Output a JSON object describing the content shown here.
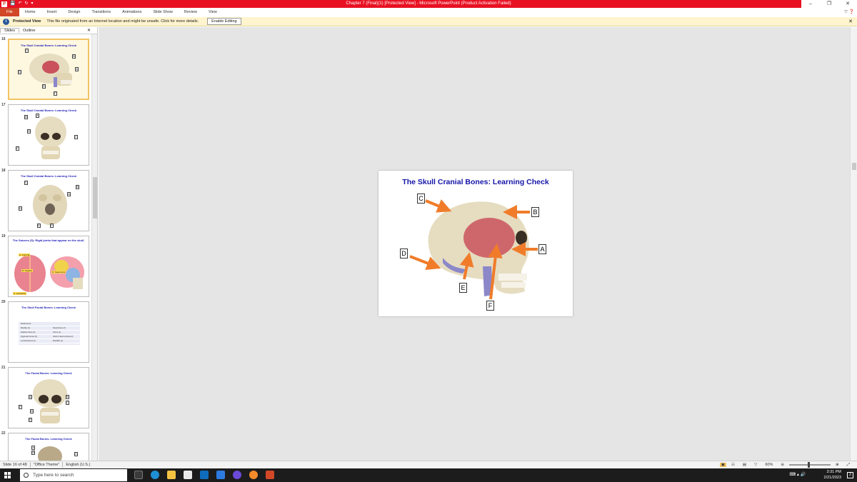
{
  "window": {
    "title": "Chapter 7 (Final)(1) [Protected View] - Microsoft PowerPoint (Product Activation Failed)",
    "app_icon": "P",
    "controls": [
      "–",
      "❐",
      "✕"
    ]
  },
  "ribbon": {
    "tabs": [
      "File",
      "Home",
      "Insert",
      "Design",
      "Transitions",
      "Animations",
      "Slide Show",
      "Review",
      "View"
    ]
  },
  "protected_view": {
    "label": "Protected View",
    "message": "This file originated from an Internet location and might be unsafe. Click for more details.",
    "button": "Enable Editing"
  },
  "slide_pane": {
    "tabs": [
      "Slides",
      "Outline"
    ],
    "thumbnails": [
      {
        "number": "16",
        "title": "The Skull Cranial Bones: Learning Check",
        "active": true
      },
      {
        "number": "17",
        "title": "The Skull Cranial Bones: Learning Check",
        "active": false
      },
      {
        "number": "18",
        "title": "The Skull Cranial Bones: Learning Check",
        "active": false
      },
      {
        "number": "19",
        "title": "The Sutures (5): Rigid joints that appear on the skull.",
        "active": false
      },
      {
        "number": "20",
        "title": "The Skull Facial Bones: Learning Check",
        "active": false
      },
      {
        "number": "21",
        "title": "The Facial Bones: Learning Check",
        "active": false
      },
      {
        "number": "22",
        "title": "The Facial Bones: Learning Check",
        "active": false
      }
    ],
    "slide19_labels": {
      "coronal_a": "A. Coronal",
      "coronal_b": "A. Coronal",
      "sagittal": "B. Sagittal",
      "lambdoid": "C. Lambdoid",
      "squamous": "D. Squamous",
      "lambdoid2": "C. Lambdoid"
    },
    "slide20_rows_left": [
      "Facial bones:",
      "Maxillae (2)",
      "Palatine bones (2)",
      "Zygomatic bones (2)",
      "Lacrimal bones (2)"
    ],
    "slide20_rows_right": [
      "",
      "Nasal bones (2)",
      "Vomer (1)",
      "Inferior nasal conchae (2)",
      "Mandible (1)"
    ]
  },
  "main_slide": {
    "title": "The Skull Cranial Bones: Learning Check",
    "labels": [
      "A",
      "B",
      "C",
      "D",
      "E",
      "F"
    ]
  },
  "status_bar": {
    "slide_info": "Slide 16 of 48",
    "theme": "\"Office Theme\"",
    "language": "English (U.S.)",
    "zoom": "60%"
  },
  "taskbar": {
    "search_placeholder": "Type here to search",
    "time": "3:31 PM",
    "date": "2/21/2023"
  },
  "colors": {
    "title_bar": "#e81123",
    "file_tab": "#d24726",
    "slide_title": "#1414a8",
    "arrow": "#f07c2a"
  }
}
